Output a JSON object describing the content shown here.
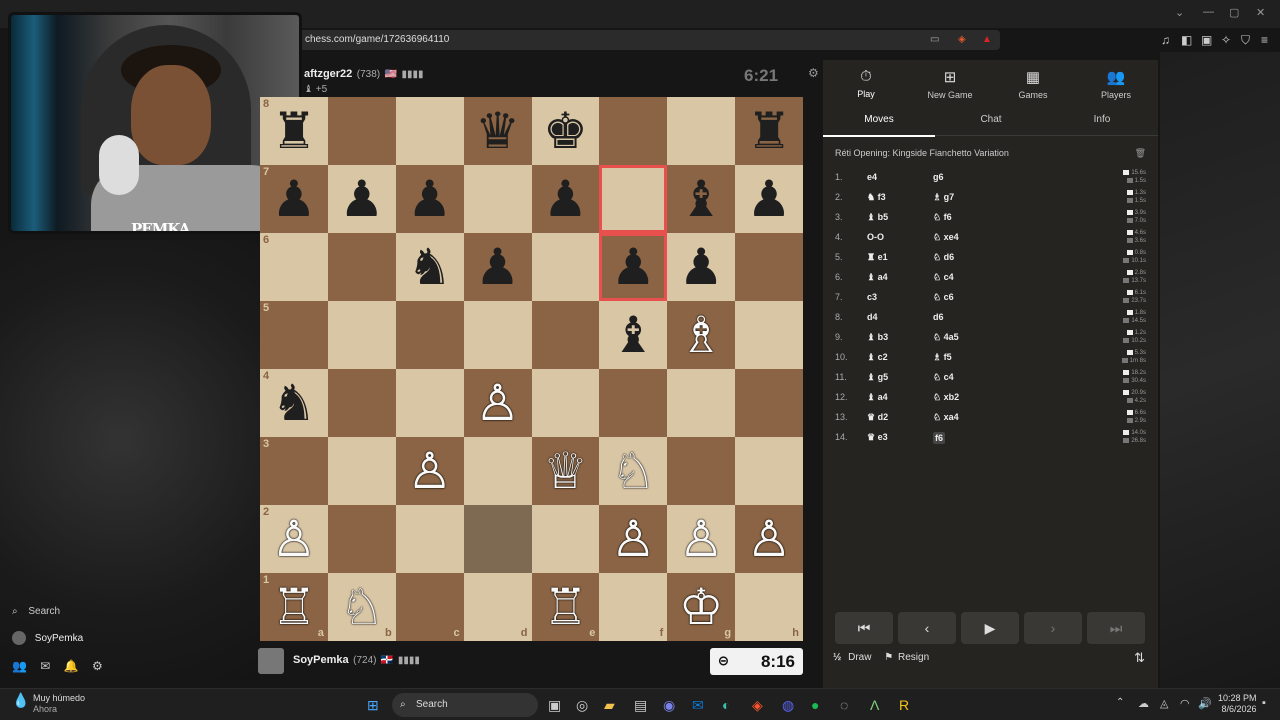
{
  "browser": {
    "url": "chess.com/game/172636964110",
    "ext_icons": [
      "cast-icon",
      "brave-shield-icon",
      "alert-icon"
    ],
    "right_icons": [
      "music-icon",
      "sidebar-icon",
      "wallet-icon",
      "extensions-icon",
      "vpn-icon",
      "menu-icon"
    ]
  },
  "webcam": {
    "watermark": "PEMKA"
  },
  "top_player": {
    "name": "aftzger22",
    "rating": "(738)",
    "flag": "🇺🇸",
    "material": "+5",
    "clock": "6:21"
  },
  "bottom_player": {
    "name": "SoyPemka",
    "rating": "(724)",
    "flag": "🇩🇴",
    "clock": "8:16"
  },
  "board": {
    "ranks": [
      "8",
      "7",
      "6",
      "5",
      "4",
      "3",
      "2",
      "1"
    ],
    "files": [
      "a",
      "b",
      "c",
      "d",
      "e",
      "f",
      "g",
      "h"
    ],
    "pieces": [
      [
        "♜",
        "",
        "",
        "♛",
        "♚",
        "",
        "",
        "♜"
      ],
      [
        "♟",
        "♟",
        "♟",
        "",
        "♟",
        "",
        "♝",
        "♟"
      ],
      [
        "",
        "",
        "♞",
        "♟",
        "",
        "♟",
        "♟",
        ""
      ],
      [
        "",
        "",
        "",
        "",
        "",
        "♝",
        "♗",
        ""
      ],
      [
        "♞",
        "",
        "",
        "♙",
        "",
        "",
        "",
        ""
      ],
      [
        "",
        "",
        "♙",
        "",
        "♕",
        "♘",
        "",
        ""
      ],
      [
        "♙",
        "",
        "",
        "",
        "",
        "♙",
        "♙",
        "♙"
      ],
      [
        "♖",
        "♘",
        "",
        "",
        "♖",
        "",
        "♔",
        ""
      ]
    ],
    "colors": [
      [
        "b",
        "",
        "",
        "b",
        "b",
        "",
        "",
        "b"
      ],
      [
        "b",
        "b",
        "b",
        "",
        "b",
        "",
        "b",
        "b"
      ],
      [
        "",
        "",
        "b",
        "b",
        "",
        "b",
        "b",
        ""
      ],
      [
        "",
        "",
        "",
        "",
        "",
        "b",
        "w",
        ""
      ],
      [
        "b",
        "",
        "",
        "w",
        "",
        "",
        "",
        ""
      ],
      [
        "",
        "",
        "w",
        "",
        "w",
        "w",
        "",
        ""
      ],
      [
        "w",
        "",
        "",
        "",
        "",
        "w",
        "w",
        "w"
      ],
      [
        "w",
        "w",
        "",
        "",
        "w",
        "",
        "w",
        ""
      ]
    ],
    "highlight": [
      [
        1,
        5
      ],
      [
        2,
        5
      ]
    ],
    "dim": [
      [
        6,
        3
      ]
    ]
  },
  "panel": {
    "nav": [
      {
        "label": "Play",
        "icon": "⏱"
      },
      {
        "label": "New Game",
        "icon": "⊞"
      },
      {
        "label": "Games",
        "icon": "▦"
      },
      {
        "label": "Players",
        "icon": "👥"
      }
    ],
    "tabs": [
      "Moves",
      "Chat",
      "Info"
    ],
    "opening": "Réti Opening: Kingside Fianchetto Variation",
    "moves": [
      {
        "n": "1.",
        "w": "e4",
        "b": "g6",
        "tw": "15.6s",
        "tb": "1.5s"
      },
      {
        "n": "2.",
        "w": "♞ f3",
        "b": "♗ g7",
        "tw": "1.3s",
        "tb": "1.5s"
      },
      {
        "n": "3.",
        "w": "♝ b5",
        "b": "♘ f6",
        "tw": "3.9s",
        "tb": "7.0s"
      },
      {
        "n": "4.",
        "w": "O-O",
        "b": "♘ xe4",
        "tw": "4.6s",
        "tb": "3.6s"
      },
      {
        "n": "5.",
        "w": "♜ e1",
        "b": "♘ d6",
        "tw": "0.8s",
        "tb": "10.1s"
      },
      {
        "n": "6.",
        "w": "♝ a4",
        "b": "♘ c4",
        "tw": "2.8s",
        "tb": "13.7s"
      },
      {
        "n": "7.",
        "w": "c3",
        "b": "♘ c6",
        "tw": "6.1s",
        "tb": "23.7s"
      },
      {
        "n": "8.",
        "w": "d4",
        "b": "d6",
        "tw": "1.8s",
        "tb": "14.5s"
      },
      {
        "n": "9.",
        "w": "♝ b3",
        "b": "♘ 4a5",
        "tw": "1.2s",
        "tb": "10.2s"
      },
      {
        "n": "10.",
        "w": "♝ c2",
        "b": "♗ f5",
        "tw": "5.3s",
        "tb": "1m 8s"
      },
      {
        "n": "11.",
        "w": "♝ g5",
        "b": "♘ c4",
        "tw": "18.2s",
        "tb": "30.4s"
      },
      {
        "n": "12.",
        "w": "♝ a4",
        "b": "♘ xb2",
        "tw": "20.9s",
        "tb": "4.2s"
      },
      {
        "n": "13.",
        "w": "♛ d2",
        "b": "♘ xa4",
        "tw": "6.6s",
        "tb": "2.9s"
      },
      {
        "n": "14.",
        "w": "♛ e3",
        "b": "f6",
        "tw": "14.0s",
        "tb": "26.8s"
      }
    ],
    "controls": [
      "⏮",
      "‹",
      "▶",
      "›",
      "⏭"
    ],
    "draw": "Draw",
    "resign": "Resign",
    "half": "½"
  },
  "sidebar": {
    "search": "Search",
    "user": "SoyPemka"
  },
  "taskbar": {
    "weather_line1": "Muy húmedo",
    "weather_line2": "Ahora",
    "search": "Search",
    "time": "10:28 PM",
    "date": "8/6/2026"
  }
}
